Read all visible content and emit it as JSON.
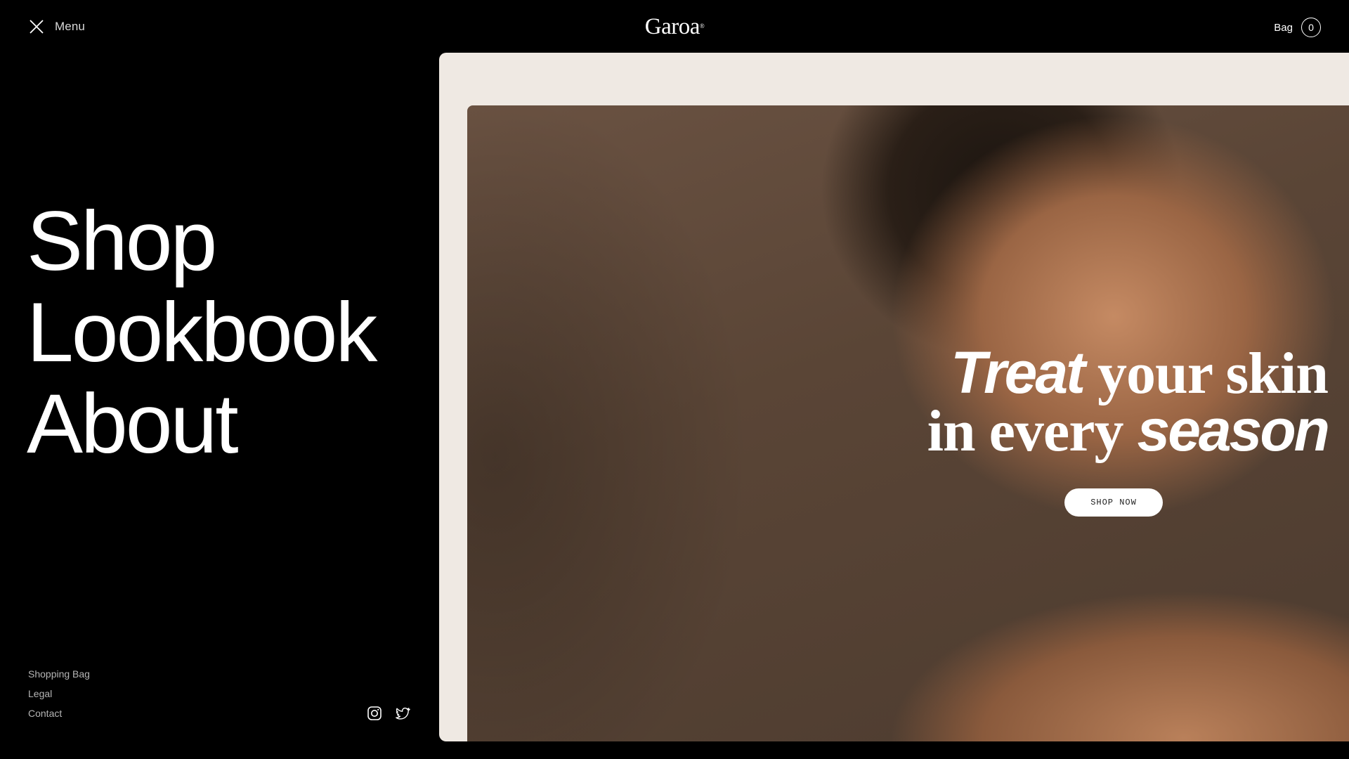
{
  "header": {
    "menu_label": "Menu",
    "logo_text": "Garoa",
    "logo_mark": "®",
    "bag_label": "Bag",
    "bag_count": "0"
  },
  "nav": {
    "items": [
      {
        "label": "Shop"
      },
      {
        "label": "Lookbook"
      },
      {
        "label": "About"
      }
    ]
  },
  "footer": {
    "links": [
      {
        "label": "Shopping Bag"
      },
      {
        "label": "Legal"
      },
      {
        "label": "Contact"
      }
    ],
    "socials": [
      {
        "icon": "instagram-icon"
      },
      {
        "icon": "twitter-icon"
      }
    ]
  },
  "hero": {
    "headline_word1": "Treat",
    "headline_word2": " your skin",
    "headline_word3": "in every ",
    "headline_word4": "season",
    "cta_label": "SHOP NOW"
  },
  "colors": {
    "background": "#000000",
    "panel": "#efe9e3",
    "text": "#ffffff",
    "muted_text": "#b5b5b5"
  }
}
